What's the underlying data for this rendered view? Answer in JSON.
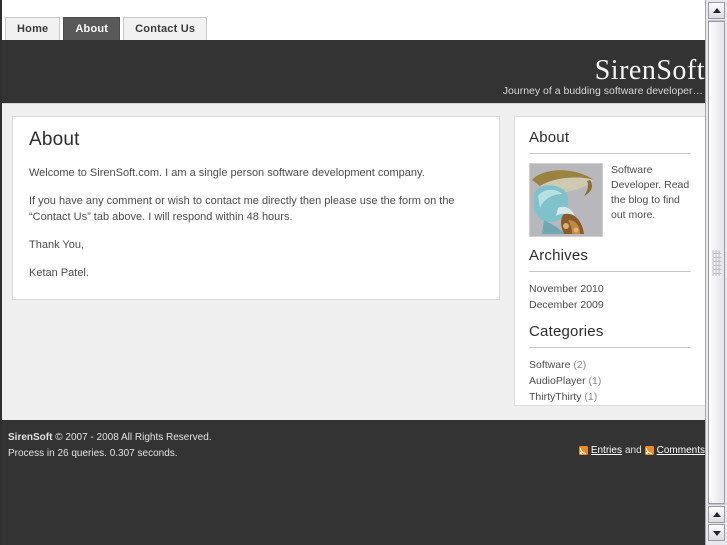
{
  "browser": {
    "scrollbar": {
      "up_arrow": "▲",
      "down_arrow": "▼"
    }
  },
  "nav": {
    "tabs": [
      {
        "label": "Home",
        "active": false
      },
      {
        "label": "About",
        "active": true
      },
      {
        "label": "Contact Us",
        "active": false
      }
    ]
  },
  "header": {
    "title": "SirenSoft",
    "tagline": "Journey of a budding software developer…"
  },
  "article": {
    "title": "About",
    "paragraphs": [
      "Welcome to SirenSoft.com. I am a single person software development company.",
      "If you have any comment or wish to contact me directly then please use the form on the “Contact Us” tab above. I will respond within 48 hours.",
      "Thank You,",
      "Ketan Patel."
    ]
  },
  "sidebar": {
    "about": {
      "heading": "About",
      "avatar_alt": "sculpture-photo",
      "text": "Software Developer. Read the blog to find out more."
    },
    "archives": {
      "heading": "Archives",
      "items": [
        {
          "label": "November 2010"
        },
        {
          "label": "December 2009"
        }
      ]
    },
    "categories": {
      "heading": "Categories",
      "items": [
        {
          "label": "Software",
          "count": "(2)"
        },
        {
          "label": "AudioPlayer",
          "count": "(1)"
        },
        {
          "label": "ThirtyThirty",
          "count": "(1)"
        }
      ]
    }
  },
  "footer": {
    "copyright_name": "SirenSoft",
    "copyright_rest": "© 2007 - 2008 All Rights Reserved.",
    "process": "Process in 26 queries. 0.307 seconds.",
    "entries_label": "Entries",
    "and_label": "and",
    "comments_label": "Comments"
  },
  "colors": {
    "header_bg": "#333333",
    "page_bg": "#efefef",
    "active_tab_bg": "#595959",
    "rss_orange": "#f08a24",
    "panel_bg": "#ffffff"
  }
}
